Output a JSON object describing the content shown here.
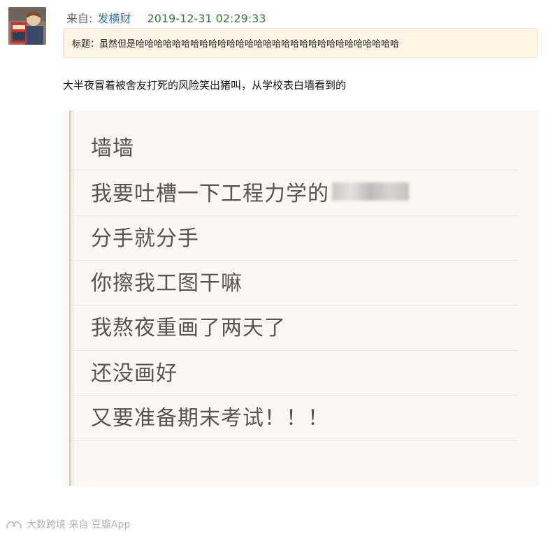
{
  "post": {
    "from_label": "来自:",
    "username": "发横财",
    "timestamp": "2019-12-31 02:29:33",
    "title": "标题：虽然但是哈哈哈哈哈哈哈哈哈哈哈哈哈哈哈哈哈哈哈哈哈哈哈哈哈哈哈哈哈",
    "body": "大半夜冒着被舍友打死的风险笑出猪叫，从学校表白墙看到的"
  },
  "image_lines": [
    "墙墙",
    "我要吐槽一下工程力学的",
    "分手就分手",
    "你擦我工图干嘛",
    "我熬夜重画了两天了",
    "还没画好",
    "又要准备期末考试！！！"
  ],
  "watermark": "大数跨境 来自 豆瓣App"
}
